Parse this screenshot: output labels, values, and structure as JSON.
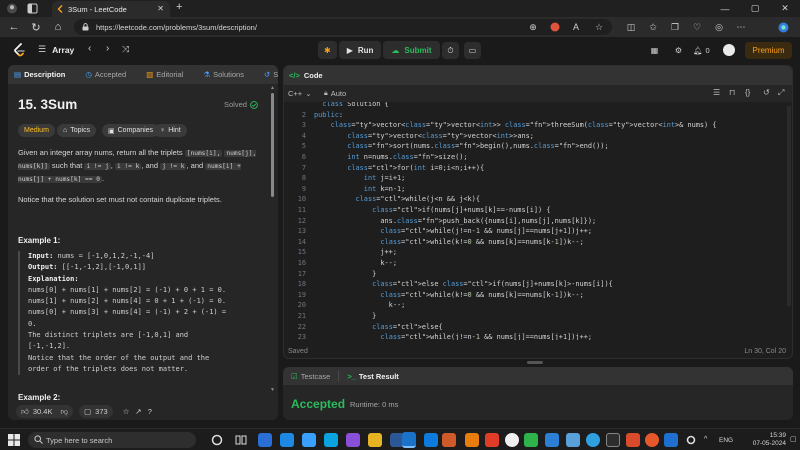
{
  "browser": {
    "tab_title": "3Sum - LeetCode",
    "url": "https://leetcode.com/problems/3sum/description/",
    "new_tab": "+",
    "close_tab": "✕"
  },
  "lc_nav": {
    "problem_list": "Array",
    "run": "Run",
    "submit": "Submit",
    "notifications_count": "0",
    "premium": "Premium"
  },
  "left_tabs": [
    {
      "label": "Description"
    },
    {
      "label": "Accepted"
    },
    {
      "label": "Editorial"
    },
    {
      "label": "Solutions"
    },
    {
      "label": "Su"
    }
  ],
  "problem": {
    "title": "15. 3Sum",
    "status": "Solved",
    "chips": {
      "difficulty": "Medium",
      "topics": "Topics",
      "companies": "Companies",
      "hint": "Hint"
    },
    "desc": {
      "p1": "Given an integer array nums, return all the triplets",
      "c1": "[nums[i],",
      "c2": "nums[j], nums[k]]",
      "p2": "such that",
      "c3": "i != j",
      "p3": ",",
      "c4": "i != k",
      "p4": ", and",
      "c5": "j != k",
      "p5": ", and",
      "c6": "nums[i] + nums[j] + nums[k] == 0",
      "p6": "."
    },
    "notice": "Notice that the solution set must not contain duplicate triplets.",
    "example1": {
      "title": "Example 1:",
      "input_label": "Input:",
      "input_value": "nums = [-1,0,1,2,-1,-4]",
      "output_label": "Output:",
      "output_value": "[[-1,-1,2],[-1,0,1]]",
      "explanation_label": "Explanation:",
      "lines": [
        "nums[0] + nums[1] + nums[2] = (-1) + 0 + 1 = 0.",
        "nums[1] + nums[2] + nums[4] = 0 + 1 + (-1) = 0.",
        "nums[0] + nums[3] + nums[4] = (-1) + 2 + (-1) =",
        "0.",
        "The distinct triplets are [-1,0,1] and",
        "[-1,-1,2].",
        "Notice that the order of the output and the",
        "order of the triplets does not matter."
      ]
    },
    "example2_title": "Example 2:"
  },
  "footer": {
    "likes": "30.4K",
    "comments": "373"
  },
  "code_panel": {
    "title": "Code",
    "language": "C++",
    "mode": "Auto",
    "saved": "Saved",
    "cursor": "Ln 30, Col 20"
  },
  "code_lines": [
    {
      "n": "",
      "text": "  class Solution {"
    },
    {
      "n": "2",
      "text": "public:"
    },
    {
      "n": "3",
      "text": "    vector<vector<int>> threeSum(vector<int>& nums) {"
    },
    {
      "n": "4",
      "text": "        vector<vector<int>>ans;"
    },
    {
      "n": "5",
      "text": "        sort(nums.begin(),nums.end());"
    },
    {
      "n": "6",
      "text": "        int n=nums.size();"
    },
    {
      "n": "7",
      "text": "        for(int i=0;i<n;i++){"
    },
    {
      "n": "8",
      "text": "            int j=i+1;"
    },
    {
      "n": "9",
      "text": "            int k=n-1;"
    },
    {
      "n": "10",
      "text": "          while(j<n && j<k){"
    },
    {
      "n": "11",
      "text": "              if(nums[j]+nums[k]==-nums[i]) {"
    },
    {
      "n": "12",
      "text": "                ans.push_back({nums[i],nums[j],nums[k]});"
    },
    {
      "n": "13",
      "text": "                while(j!=n-1 && nums[j]==nums[j+1])j++;"
    },
    {
      "n": "14",
      "text": "                while(k!=0 && nums[k]==nums[k-1])k--;"
    },
    {
      "n": "15",
      "text": "                j++;"
    },
    {
      "n": "16",
      "text": "                k--;"
    },
    {
      "n": "17",
      "text": "              }"
    },
    {
      "n": "18",
      "text": "              else if(nums[j]+nums[k]>-nums[i]){"
    },
    {
      "n": "19",
      "text": "                while(k!=0 && nums[k]==nums[k-1])k--;"
    },
    {
      "n": "20",
      "text": "                  k--;"
    },
    {
      "n": "21",
      "text": "              }"
    },
    {
      "n": "22",
      "text": "              else{"
    },
    {
      "n": "23",
      "text": "                while(j!=n-1 && nums[j]==nums[j+1])j++;"
    }
  ],
  "result_panel": {
    "testcase_tab": "Testcase",
    "result_tab": "Test Result",
    "verdict": "Accepted",
    "runtime": "Runtime: 0 ms"
  },
  "taskbar": {
    "search_placeholder": "Type here to search",
    "language": "ENG",
    "time": "15:39",
    "date": "07-05-2024"
  },
  "colors": {
    "accepted_green": "#2cbb5d",
    "brand_orange": "#ffa116",
    "medium_yellow": "#ffc01e"
  }
}
